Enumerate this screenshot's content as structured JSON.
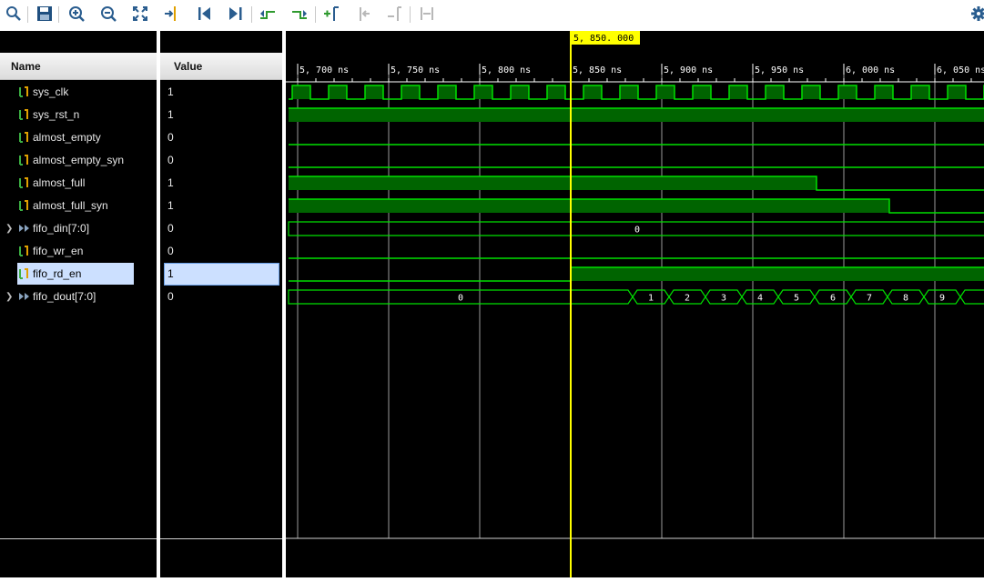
{
  "toolbar": {
    "buttons": [
      {
        "icon": "search-icon"
      },
      {
        "icon": "save-icon"
      },
      {
        "icon": "zoom-in-icon"
      },
      {
        "icon": "zoom-out-icon"
      },
      {
        "icon": "zoom-fit-icon"
      },
      {
        "icon": "go-to-cursor-icon"
      },
      {
        "icon": "go-to-time-zero-icon"
      },
      {
        "icon": "go-to-last-time-icon"
      },
      {
        "icon": "previous-transition-icon"
      },
      {
        "icon": "next-transition-icon"
      },
      {
        "icon": "add-marker-icon"
      },
      {
        "icon": "previous-marker-icon"
      },
      {
        "icon": "next-marker-icon"
      },
      {
        "icon": "swap-cursors-icon"
      }
    ],
    "settings_icon": "gear-icon"
  },
  "columns": {
    "name": "Name",
    "value": "Value"
  },
  "signals": [
    {
      "name": "sys_clk",
      "value": "1",
      "kind": "bit",
      "expandable": false,
      "selected": false
    },
    {
      "name": "sys_rst_n",
      "value": "1",
      "kind": "bit",
      "expandable": false,
      "selected": false
    },
    {
      "name": "almost_empty",
      "value": "0",
      "kind": "bit",
      "expandable": false,
      "selected": false
    },
    {
      "name": "almost_empty_syn",
      "value": "0",
      "kind": "bit",
      "expandable": false,
      "selected": false
    },
    {
      "name": "almost_full",
      "value": "1",
      "kind": "bit",
      "expandable": false,
      "selected": false
    },
    {
      "name": "almost_full_syn",
      "value": "1",
      "kind": "bit",
      "expandable": false,
      "selected": false
    },
    {
      "name": "fifo_din[7:0]",
      "value": "0",
      "kind": "bus",
      "expandable": true,
      "selected": false
    },
    {
      "name": "fifo_wr_en",
      "value": "0",
      "kind": "bit",
      "expandable": false,
      "selected": false
    },
    {
      "name": "fifo_rd_en",
      "value": "1",
      "kind": "bit",
      "expandable": false,
      "selected": true
    },
    {
      "name": "fifo_dout[7:0]",
      "value": "0",
      "kind": "bus",
      "expandable": true,
      "selected": false
    }
  ],
  "waveform": {
    "time_unit": "ns",
    "view_start_ns": 5695,
    "view_end_ns": 6078,
    "ticks": [
      {
        "t": 5700,
        "label": "5, 700 ns"
      },
      {
        "t": 5750,
        "label": "5, 750 ns"
      },
      {
        "t": 5800,
        "label": "5, 800 ns"
      },
      {
        "t": 5850,
        "label": "5, 850 ns"
      },
      {
        "t": 5900,
        "label": "5, 900 ns"
      },
      {
        "t": 5950,
        "label": "5, 950 ns"
      },
      {
        "t": 6000,
        "label": "6, 000 ns"
      },
      {
        "t": 6050,
        "label": "6, 050 ns"
      }
    ],
    "cursor_ns": 5850,
    "cursor_label": "5, 850. 000 ns",
    "colors": {
      "wave": "#00e000",
      "fill": "#006400",
      "cursor": "#ffff00",
      "grid": "#c8c8c8",
      "bus_text": "#ffffff",
      "tick_text": "#ffffff"
    },
    "clock": {
      "period_ns": 20,
      "high_start_ns": 5697
    },
    "traces": [
      {
        "type": "clock"
      },
      {
        "type": "bit",
        "segments": [
          {
            "from": 5695,
            "to": 6078,
            "v": 1
          }
        ]
      },
      {
        "type": "bit",
        "segments": [
          {
            "from": 5695,
            "to": 6078,
            "v": 0
          }
        ]
      },
      {
        "type": "bit",
        "segments": [
          {
            "from": 5695,
            "to": 6078,
            "v": 0
          }
        ]
      },
      {
        "type": "bit",
        "segments": [
          {
            "from": 5695,
            "to": 5985,
            "v": 1
          },
          {
            "from": 5985,
            "to": 6078,
            "v": 0
          }
        ]
      },
      {
        "type": "bit",
        "segments": [
          {
            "from": 5695,
            "to": 6025,
            "v": 1
          },
          {
            "from": 6025,
            "to": 6078,
            "v": 0
          }
        ]
      },
      {
        "type": "bus",
        "segments": [
          {
            "from": 5695,
            "to": 6078,
            "label": "0"
          }
        ]
      },
      {
        "type": "bit",
        "segments": [
          {
            "from": 5695,
            "to": 6078,
            "v": 0
          }
        ]
      },
      {
        "type": "bit",
        "segments": [
          {
            "from": 5695,
            "to": 5850,
            "v": 0
          },
          {
            "from": 5850,
            "to": 6078,
            "v": 1
          }
        ]
      },
      {
        "type": "bus",
        "segments": [
          {
            "from": 5695,
            "to": 5884,
            "label": "0"
          },
          {
            "from": 5884,
            "to": 5904,
            "label": "1"
          },
          {
            "from": 5904,
            "to": 5924,
            "label": "2"
          },
          {
            "from": 5924,
            "to": 5944,
            "label": "3"
          },
          {
            "from": 5944,
            "to": 5964,
            "label": "4"
          },
          {
            "from": 5964,
            "to": 5984,
            "label": "5"
          },
          {
            "from": 5984,
            "to": 6004,
            "label": "6"
          },
          {
            "from": 6004,
            "to": 6024,
            "label": "7"
          },
          {
            "from": 6024,
            "to": 6044,
            "label": "8"
          },
          {
            "from": 6044,
            "to": 6064,
            "label": "9"
          },
          {
            "from": 6064,
            "to": 6078,
            "label": ""
          }
        ]
      }
    ]
  }
}
